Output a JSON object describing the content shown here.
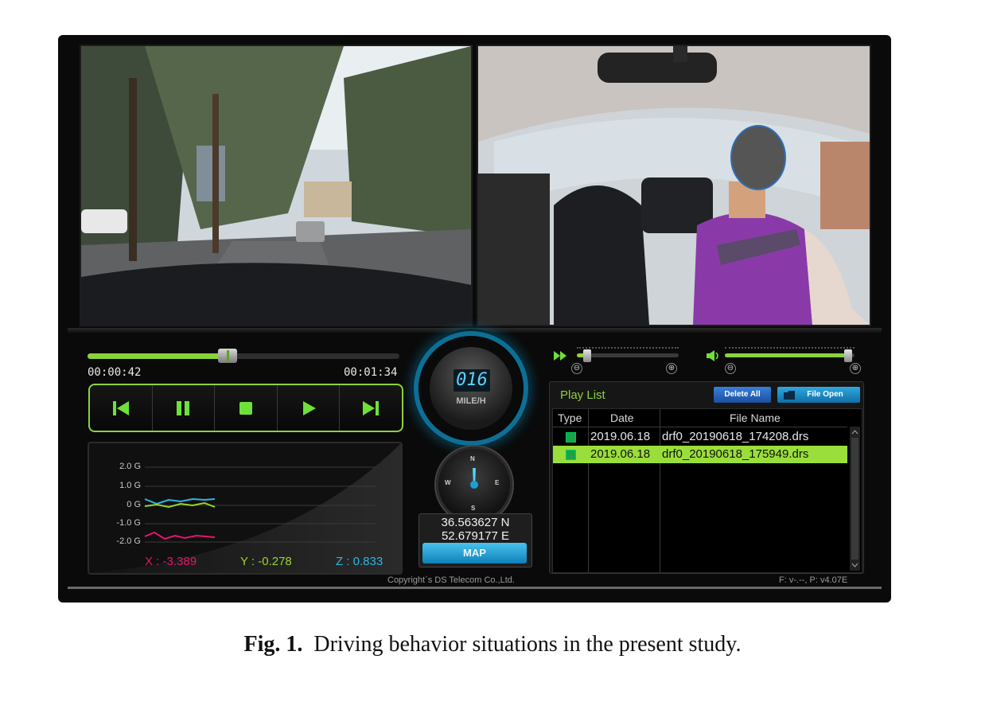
{
  "player": {
    "time_elapsed": "00:00:42",
    "time_total": "00:01:34",
    "progress": 0.45,
    "controls": [
      "skip-back",
      "pause",
      "stop",
      "play",
      "skip-forward"
    ],
    "speed": {
      "value": "016",
      "unit": "MILE/H"
    },
    "compass": {
      "n": "N",
      "e": "E",
      "s": "S",
      "w": "W"
    },
    "gps": {
      "lat": "36.563627 N",
      "lon": "52.679177 E",
      "map_label": "MAP"
    },
    "playback_speed_level": 0.1,
    "volume_level": 0.95,
    "minus": "⊖",
    "plus": "⊕"
  },
  "gsensor": {
    "ticks": [
      "2.0 G",
      "1.0 G",
      "0 G",
      "-1.0 G",
      "-2.0 G"
    ],
    "x_label": "X : -3.389",
    "y_label": "Y : -0.278",
    "z_label": "Z : 0.833",
    "colors": {
      "x": "#e3166a",
      "y": "#9ad42a",
      "z": "#2bb7e6"
    }
  },
  "playlist": {
    "title": "Play List",
    "delete_all": "Delete All",
    "file_open": "File Open",
    "headers": {
      "type": "Type",
      "date": "Date",
      "file_name": "File Name"
    },
    "rows": [
      {
        "type": "N",
        "date": "2019.06.18",
        "file": "drf0_20190618_174208.drs"
      },
      {
        "type": "N",
        "date": "2019.06.18",
        "file": "drf0_20190618_175949.drs"
      }
    ]
  },
  "footer": {
    "copyright": "Copyright`s DS Telecom Co.,Ltd.",
    "version": "F: v-.--, P: v4.07E"
  },
  "caption": {
    "label": "Fig. 1.",
    "text": "Driving behavior situations in the present study."
  }
}
